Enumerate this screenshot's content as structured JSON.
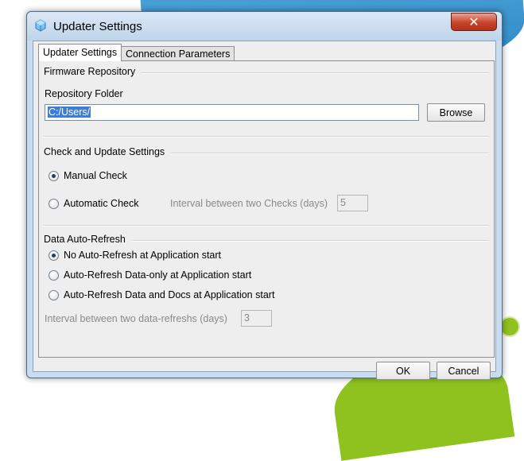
{
  "window": {
    "title": "Updater Settings",
    "close_glyph": "✕",
    "icon": "app-cube-icon"
  },
  "tabs": [
    {
      "label": "Updater Settings",
      "active": true
    },
    {
      "label": "Connection Parameters",
      "active": false
    }
  ],
  "firmware": {
    "group_title": "Firmware Repository",
    "folder_label": "Repository Folder",
    "folder_value": "C:/Users/",
    "browse_label": "Browse"
  },
  "check_update": {
    "group_title": "Check and Update Settings",
    "manual_label": "Manual Check",
    "manual_selected": true,
    "automatic_label": "Automatic Check",
    "automatic_selected": false,
    "interval_label": "Interval between two Checks (days)",
    "interval_value": "5"
  },
  "auto_refresh": {
    "group_title": "Data Auto-Refresh",
    "options": [
      {
        "label": "No Auto-Refresh at Application start",
        "selected": true
      },
      {
        "label": "Auto-Refresh Data-only at Application start",
        "selected": false
      },
      {
        "label": "Auto-Refresh Data and Docs at Application start",
        "selected": false
      }
    ],
    "interval_label": "Interval between two data-refreshs (days)",
    "interval_value": "3"
  },
  "footer": {
    "ok_label": "OK",
    "cancel_label": "Cancel"
  },
  "colors": {
    "title_bar": "#c9dcef",
    "close_button": "#c7432a",
    "selection": "#3b7dd8"
  }
}
